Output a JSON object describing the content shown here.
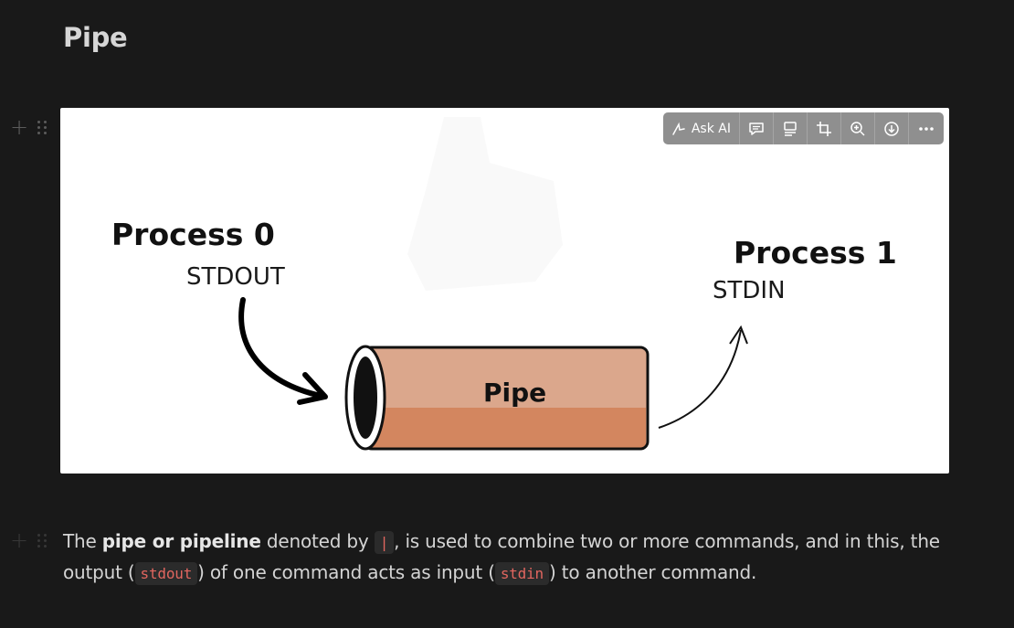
{
  "page": {
    "title": "Pipe"
  },
  "image_toolbar": {
    "ask_ai_label": "Ask AI",
    "buttons": [
      "ask-ai",
      "comment",
      "caption",
      "crop",
      "zoom-in",
      "download",
      "more"
    ]
  },
  "diagram": {
    "process0_title": "Process 0",
    "process0_stream": "STDOUT",
    "process1_title": "Process 1",
    "process1_stream": "STDIN",
    "pipe_label": "Pipe"
  },
  "paragraph": {
    "t1": "The ",
    "bold": "pipe or pipeline",
    "t2": " denoted by ",
    "code1": "|",
    "t3": ", is used to combine two or more commands, and in this, the output (",
    "code2": "stdout",
    "t4": ") of one command acts as input (",
    "code3": "stdin",
    "t5": ") to another command."
  },
  "colors": {
    "background": "#191919",
    "pipe_top": "#dba78c",
    "pipe_bottom": "#d3865f",
    "code_text": "#e2665f",
    "toolbar": "#8f8f8f"
  }
}
